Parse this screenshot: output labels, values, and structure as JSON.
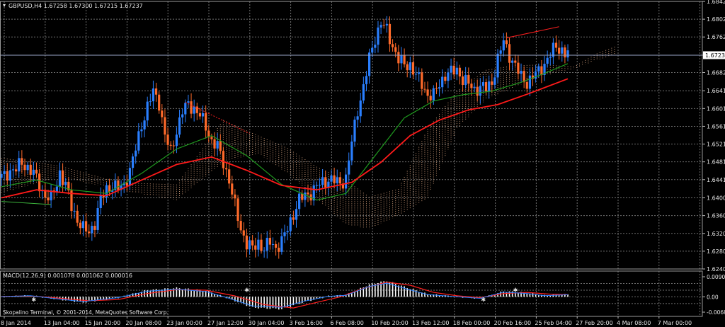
{
  "chart_data": {
    "type": "candlestick",
    "symbol_header": "GBPUSD,H4  1.67258 1.67300 1.67215 1.67237",
    "current_price": 1.67237,
    "current_price_label": "1.67237",
    "y_axis": {
      "range": [
        1.624,
        1.6842
      ],
      "ticks": [
        "1.68420",
        "1.68020",
        "1.67620",
        "1.67237",
        "1.66820",
        "1.66410",
        "1.66010",
        "1.65610",
        "1.65210",
        "1.64810",
        "1.64410",
        "1.64000",
        "1.63600",
        "1.63200",
        "1.62800",
        "1.62400"
      ],
      "tick_values": [
        1.6842,
        1.6802,
        1.6762,
        1.67237,
        1.6682,
        1.6641,
        1.6601,
        1.6561,
        1.6521,
        1.6481,
        1.6441,
        1.64,
        1.636,
        1.632,
        1.628,
        1.624
      ]
    },
    "x_axis": {
      "labels": [
        "8 Jan 2014",
        "13 Jan 04:00",
        "15 Jan 20:00",
        "20 Jan 08:00",
        "23 Jan 00:00",
        "27 Jan 12:00",
        "30 Jan 04:00",
        "3 Feb 16:00",
        "6 Feb 08:00",
        "10 Feb 20:00",
        "13 Feb 12:00",
        "18 Feb 00:00",
        "20 Feb 16:00",
        "25 Feb 04:00",
        "27 Feb 20:00",
        "4 Mar 08:00",
        "7 Mar 00:00"
      ]
    },
    "price_path": [
      [
        0,
        1.6445
      ],
      [
        2,
        1.6448
      ],
      [
        4,
        1.6462
      ],
      [
        6,
        1.6465
      ],
      [
        8,
        1.6478
      ],
      [
        10,
        1.6469
      ],
      [
        12,
        1.6455
      ],
      [
        14,
        1.6428
      ],
      [
        16,
        1.6405
      ],
      [
        18,
        1.6398
      ],
      [
        20,
        1.6432
      ],
      [
        21,
        1.6458
      ],
      [
        23,
        1.6428
      ],
      [
        25,
        1.638
      ],
      [
        27,
        1.6352
      ],
      [
        29,
        1.633
      ],
      [
        31,
        1.6322
      ],
      [
        33,
        1.6345
      ],
      [
        35,
        1.6395
      ],
      [
        37,
        1.642
      ],
      [
        39,
        1.6428
      ],
      [
        41,
        1.642
      ],
      [
        43,
        1.643
      ],
      [
        45,
        1.6462
      ],
      [
        47,
        1.651
      ],
      [
        49,
        1.6565
      ],
      [
        51,
        1.6605
      ],
      [
        53,
        1.6638
      ],
      [
        55,
        1.6615
      ],
      [
        57,
        1.654
      ],
      [
        59,
        1.6502
      ],
      [
        61,
        1.6552
      ],
      [
        63,
        1.6595
      ],
      [
        65,
        1.661
      ],
      [
        67,
        1.6602
      ],
      [
        69,
        1.6585
      ],
      [
        71,
        1.656
      ],
      [
        73,
        1.6528
      ],
      [
        75,
        1.6515
      ],
      [
        77,
        1.648
      ],
      [
        79,
        1.644
      ],
      [
        81,
        1.638
      ],
      [
        83,
        1.633
      ],
      [
        85,
        1.6298
      ],
      [
        87,
        1.6285
      ],
      [
        89,
        1.63
      ],
      [
        91,
        1.6285
      ],
      [
        93,
        1.63
      ],
      [
        95,
        1.6288
      ],
      [
        97,
        1.6302
      ],
      [
        99,
        1.633
      ],
      [
        101,
        1.6365
      ],
      [
        103,
        1.6395
      ],
      [
        105,
        1.6405
      ],
      [
        107,
        1.6412
      ],
      [
        109,
        1.6425
      ],
      [
        111,
        1.6435
      ],
      [
        113,
        1.6442
      ],
      [
        115,
        1.6438
      ],
      [
        117,
        1.6432
      ],
      [
        119,
        1.6445
      ],
      [
        121,
        1.6525
      ],
      [
        123,
        1.6598
      ],
      [
        125,
        1.665
      ],
      [
        127,
        1.6712
      ],
      [
        129,
        1.676
      ],
      [
        131,
        1.6795
      ],
      [
        133,
        1.6775
      ],
      [
        135,
        1.6742
      ],
      [
        137,
        1.6712
      ],
      [
        139,
        1.6698
      ],
      [
        141,
        1.67
      ],
      [
        143,
        1.6676
      ],
      [
        145,
        1.6655
      ],
      [
        147,
        1.6632
      ],
      [
        149,
        1.663
      ],
      [
        151,
        1.6656
      ],
      [
        153,
        1.6678
      ],
      [
        155,
        1.6682
      ],
      [
        157,
        1.6688
      ],
      [
        159,
        1.6668
      ],
      [
        161,
        1.6655
      ],
      [
        163,
        1.6643
      ],
      [
        165,
        1.6651
      ],
      [
        167,
        1.6645
      ],
      [
        169,
        1.666
      ],
      [
        171,
        1.6712
      ],
      [
        173,
        1.6752
      ],
      [
        175,
        1.6722
      ],
      [
        177,
        1.6696
      ],
      [
        179,
        1.6672
      ],
      [
        181,
        1.666
      ],
      [
        183,
        1.6672
      ],
      [
        185,
        1.6685
      ],
      [
        187,
        1.6702
      ],
      [
        189,
        1.6722
      ],
      [
        191,
        1.6742
      ],
      [
        193,
        1.6732
      ],
      [
        194,
        1.6724
      ]
    ],
    "ma_red": [
      [
        0,
        1.64
      ],
      [
        12,
        1.6418
      ],
      [
        24,
        1.641
      ],
      [
        36,
        1.6405
      ],
      [
        48,
        1.644
      ],
      [
        60,
        1.6475
      ],
      [
        72,
        1.6492
      ],
      [
        84,
        1.6462
      ],
      [
        96,
        1.6428
      ],
      [
        108,
        1.6418
      ],
      [
        120,
        1.6435
      ],
      [
        130,
        1.648
      ],
      [
        140,
        1.654
      ],
      [
        150,
        1.6575
      ],
      [
        160,
        1.6598
      ],
      [
        170,
        1.661
      ],
      [
        180,
        1.6633
      ],
      [
        194,
        1.6668
      ]
    ],
    "ma_green": [
      [
        0,
        1.6425
      ],
      [
        12,
        1.644
      ],
      [
        24,
        1.6418
      ],
      [
        36,
        1.641
      ],
      [
        48,
        1.6455
      ],
      [
        60,
        1.651
      ],
      [
        72,
        1.654
      ],
      [
        84,
        1.6495
      ],
      [
        96,
        1.643
      ],
      [
        108,
        1.6395
      ],
      [
        118,
        1.641
      ],
      [
        128,
        1.6495
      ],
      [
        138,
        1.658
      ],
      [
        148,
        1.6618
      ],
      [
        158,
        1.6632
      ],
      [
        168,
        1.664
      ],
      [
        178,
        1.666
      ],
      [
        186,
        1.668
      ],
      [
        194,
        1.6702
      ]
    ],
    "cloud_span_a": [
      [
        0,
        1.649
      ],
      [
        20,
        1.6472
      ],
      [
        40,
        1.6435
      ],
      [
        60,
        1.643
      ],
      [
        76,
        1.6575
      ],
      [
        88,
        1.654
      ],
      [
        98,
        1.6512
      ],
      [
        108,
        1.647
      ],
      [
        118,
        1.644
      ],
      [
        126,
        1.6402
      ],
      [
        136,
        1.642
      ],
      [
        146,
        1.6555
      ],
      [
        156,
        1.664
      ],
      [
        166,
        1.6688
      ],
      [
        176,
        1.6698
      ],
      [
        186,
        1.67
      ],
      [
        196,
        1.6695
      ],
      [
        204,
        1.6725
      ],
      [
        210,
        1.674
      ]
    ],
    "cloud_span_b": [
      [
        0,
        1.641
      ],
      [
        20,
        1.6448
      ],
      [
        40,
        1.6418
      ],
      [
        60,
        1.6395
      ],
      [
        76,
        1.648
      ],
      [
        88,
        1.65
      ],
      [
        98,
        1.6455
      ],
      [
        108,
        1.6398
      ],
      [
        118,
        1.634
      ],
      [
        126,
        1.633
      ],
      [
        136,
        1.636
      ],
      [
        146,
        1.64
      ],
      [
        156,
        1.6555
      ],
      [
        166,
        1.6622
      ],
      [
        176,
        1.665
      ],
      [
        186,
        1.6675
      ],
      [
        196,
        1.669
      ],
      [
        204,
        1.671
      ],
      [
        210,
        1.6722
      ]
    ],
    "trendlines": [
      {
        "color": "#ff2020",
        "points": [
          [
            173,
            1.676
          ],
          [
            191,
            1.6785
          ]
        ]
      },
      {
        "color": "#ff2020",
        "points": [
          [
            63,
            1.6615
          ],
          [
            85,
            1.6545
          ]
        ]
      },
      {
        "color": "#3cb43c",
        "points": [
          [
            0,
            1.6392
          ],
          [
            17,
            1.6385
          ]
        ]
      }
    ],
    "macd": {
      "label": "MACD(12,26,9) 0.001078 0.001062 0.000016",
      "range": [
        -0.006874,
        0.00903
      ],
      "ticks": [
        "0.00903",
        "0.00",
        "-0.006874"
      ],
      "tick_values": [
        0.00903,
        0,
        -0.006874
      ],
      "hist": [
        [
          0,
          0.0001
        ],
        [
          10,
          0.0006
        ],
        [
          20,
          -0.0012
        ],
        [
          28,
          -0.0025
        ],
        [
          40,
          -0.0004
        ],
        [
          50,
          0.003
        ],
        [
          60,
          0.004
        ],
        [
          70,
          0.0028
        ],
        [
          78,
          -0.0008
        ],
        [
          86,
          -0.0048
        ],
        [
          96,
          -0.0055
        ],
        [
          104,
          -0.0022
        ],
        [
          112,
          0.0003
        ],
        [
          118,
          0.0008
        ],
        [
          126,
          0.0055
        ],
        [
          132,
          0.0072
        ],
        [
          138,
          0.0045
        ],
        [
          146,
          0.0012
        ],
        [
          154,
          0.0003
        ],
        [
          164,
          -0.0008
        ],
        [
          172,
          0.0025
        ],
        [
          180,
          0.0018
        ],
        [
          186,
          0.0006
        ],
        [
          194,
          0.0011
        ]
      ],
      "signal": [
        [
          0,
          0.0002
        ],
        [
          10,
          0.0004
        ],
        [
          20,
          -0.0006
        ],
        [
          30,
          -0.0018
        ],
        [
          40,
          -0.0012
        ],
        [
          50,
          0.0015
        ],
        [
          60,
          0.0032
        ],
        [
          70,
          0.003
        ],
        [
          80,
          0.0004
        ],
        [
          90,
          -0.0035
        ],
        [
          100,
          -0.005
        ],
        [
          108,
          -0.0025
        ],
        [
          116,
          0.0
        ],
        [
          124,
          0.0038
        ],
        [
          132,
          0.0066
        ],
        [
          140,
          0.0052
        ],
        [
          148,
          0.002
        ],
        [
          156,
          0.0005
        ],
        [
          164,
          -0.0004
        ],
        [
          172,
          0.0015
        ],
        [
          180,
          0.002
        ],
        [
          188,
          0.0012
        ],
        [
          194,
          0.001
        ]
      ],
      "colors": {
        "hist": "#ffffff",
        "signal": "#ff2020",
        "line": "#2a7fff"
      }
    },
    "colors": {
      "bull_candle": "#2a7fff",
      "bear_candle": "#ff6a2a",
      "ma_red": "#ff1a1a",
      "ma_green": "#1f9a1f",
      "cloud": "#e8b08a",
      "grid": "#6f6f6f",
      "price_line": "#9aa6c8"
    },
    "grid": true
  },
  "footer": {
    "copyright": "Skopalino Terminal, © 2001-2014, MetaQuotes Software Corp."
  }
}
